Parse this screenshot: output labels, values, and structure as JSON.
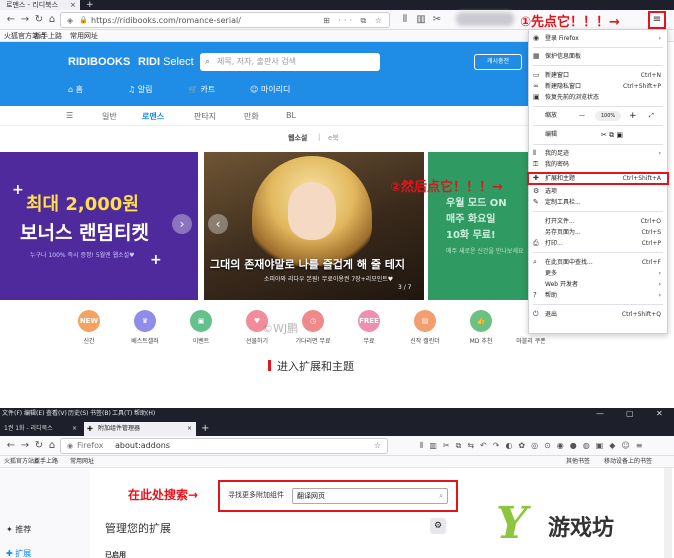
{
  "top": {
    "tab_title": "로맨스 - 리디북스",
    "tab_close": "×",
    "tab_new": "+",
    "url": "https://ridibooks.com/romance-serial/",
    "annotation_first": "①先点它！！！→",
    "hamburger": "≡",
    "bookmarks": [
      "火狐官方站点",
      "新手上路",
      "常用网址"
    ],
    "ridi": {
      "logo": "RIDIBOOKS",
      "select_bold": "RIDI",
      "select_rest": "Select",
      "search_placeholder": "제목, 저자, 출판사 검색",
      "cash_button": "캐시충전",
      "nav": [
        "홈",
        "알림",
        "카트",
        "마이리디"
      ],
      "subnav": [
        "일반",
        "로맨스",
        "판타지",
        "만화",
        "BL"
      ],
      "crumbs": [
        "웹소설",
        "e북"
      ]
    },
    "banners": {
      "left_line1": "최대 2,000원",
      "left_line2": "보너스 랜덤티켓",
      "left_line3": "누구나 100% 즉시 증정! 5월엔 웹소설♥",
      "mid_title": "그대의 존재야말로 나를 즐겁게 해 줄 테지",
      "mid_sub": "소피아와 리다우 본원! 무료이용권 7장+리모인트♥",
      "mid_page": "3 / 7",
      "right_line1": "우월 모드 ON",
      "right_line2": "매주 화요일",
      "right_line3": "10화 무료!",
      "right_line4": "매주 새로운 신간을 만나보세요"
    },
    "annotation_second": "②然后点它！！！→",
    "shortcuts": [
      {
        "badge": "NEW",
        "label": "신간",
        "color": "#f4a261"
      },
      {
        "badge": "♛",
        "label": "베스트셀러",
        "color": "#8f8de8"
      },
      {
        "badge": "▣",
        "label": "이벤트",
        "color": "#65c18c"
      },
      {
        "badge": "♥",
        "label": "선물하기",
        "color": "#f28b9a"
      },
      {
        "badge": "◷",
        "label": "기다리면 무료",
        "color": "#f08a8a"
      },
      {
        "badge": "FREE",
        "label": "무료",
        "color": "#ee8fb0"
      },
      {
        "badge": "▤",
        "label": "신작 캘린더",
        "color": "#f29e6f"
      },
      {
        "badge": "👍",
        "label": "MD 추천",
        "color": "#6cc082"
      },
      {
        "badge": "",
        "label": "마블리 쿠폰",
        "color": "#ffffff"
      }
    ],
    "watermark": "©WJ鹏",
    "caption": "进入扩展和主题",
    "menu": {
      "login": "登录 Firefox",
      "privacy": "保护信息面板",
      "new_window": "新建窗口",
      "new_window_sc": "Ctrl+N",
      "new_private": "新建隐私窗口",
      "new_private_sc": "Ctrl+Shift+P",
      "restore": "恢复先前的浏览状态",
      "zoom_label": "缩放",
      "zoom_minus": "—",
      "zoom_value": "100%",
      "zoom_plus": "+",
      "zoom_full": "⤢",
      "edit_label": "编辑",
      "edit_icons": "✂  ⧉  ▣",
      "library": "我的足迹",
      "passwords": "我的密码",
      "addons": "扩展和主题",
      "addons_sc": "Ctrl+Shift+A",
      "options": "选项",
      "customize": "定制工具栏...",
      "open_file": "打开文件...",
      "open_file_sc": "Ctrl+O",
      "save_as": "另存页面为...",
      "save_as_sc": "Ctrl+S",
      "print": "打印...",
      "print_sc": "Ctrl+P",
      "find": "在此页面中查找...",
      "find_sc": "Ctrl+F",
      "more": "更多",
      "web_dev": "Web 开发者",
      "help": "帮助",
      "quit": "退出",
      "quit_sc": "Ctrl+Shift+Q"
    }
  },
  "bottom": {
    "menubar": [
      "文件(F)",
      "编辑(E)",
      "查看(V)",
      "历史(S)",
      "书签(B)",
      "工具(T)",
      "帮助(H)"
    ],
    "win_min": "—",
    "win_max": "▢",
    "win_close": "✕",
    "tab1": "1권 1화 - 리디북스",
    "tab2": "附加组件管理器",
    "tab_close": "×",
    "tab_new": "+",
    "url_scheme": "Firefox",
    "url": "about:addons",
    "bookmarks": [
      "火狐官方站点",
      "新手上路",
      "常用网址"
    ],
    "bookmarks_right": [
      "其他书签",
      "移动设备上的书签"
    ],
    "sidebar": [
      "推荐",
      "扩展"
    ],
    "annotation_search": "在此处搜索→",
    "search_label": "寻找更多附加组件",
    "search_value": "翻译网页",
    "manage_title": "管理您的扩展",
    "enabled": "已启用",
    "logo_text": "游戏坊"
  }
}
